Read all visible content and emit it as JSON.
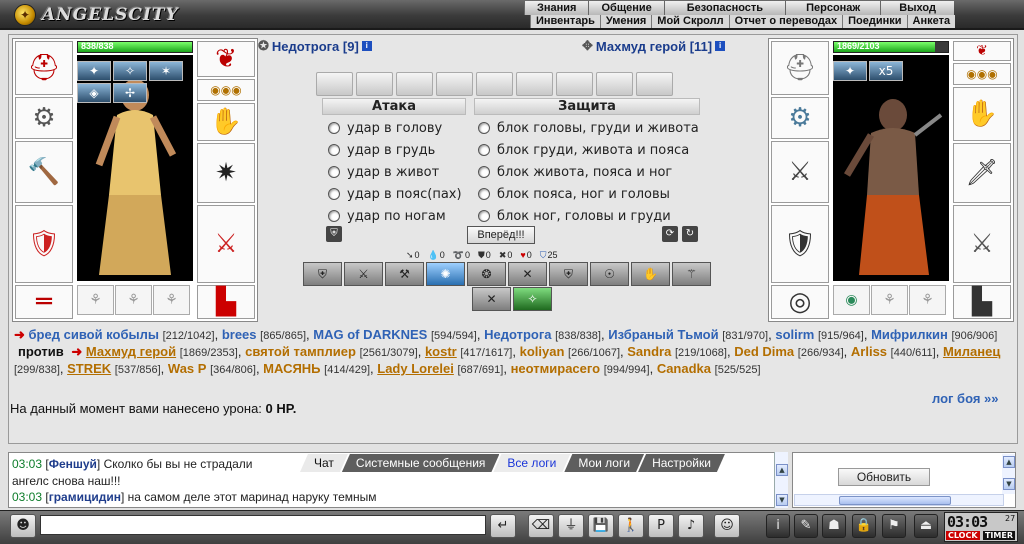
{
  "app": {
    "logo_text": "ANGELSCITY"
  },
  "top_menu": {
    "primary": [
      "Знания",
      "Общение",
      "Безопасность",
      "Персонаж",
      "Выход"
    ],
    "secondary": [
      "Инвентарь",
      "Умения",
      "Мой Скролл",
      "Отчет о переводах",
      "Поединки",
      "Анкета"
    ]
  },
  "player_left": {
    "name": "Недотрога [9]",
    "hp": "838/838",
    "hp_fraction": 1.0,
    "effects": [
      "✦",
      "✧",
      "✶",
      "◈",
      "✢"
    ]
  },
  "player_right": {
    "name": "Махмуд герой [11]",
    "hp": "1869/2103",
    "hp_fraction": 0.889,
    "effect_badge": "x5"
  },
  "attack": {
    "title": "Атака",
    "options": [
      "удар в голову",
      "удар в грудь",
      "удар в живот",
      "удар в пояс(пах)",
      "удар по ногам"
    ]
  },
  "defense": {
    "title": "Защита",
    "options": [
      "блок головы, груди и живота",
      "блок груди, живота и пояса",
      "блок живота, пояса и ног",
      "блок пояса, ног и головы",
      "блок ног, головы и груди"
    ]
  },
  "forward_button": "Вперёд!!!",
  "counters": [
    "0",
    "0",
    "0",
    "0",
    "0",
    "0",
    "25"
  ],
  "team_left": [
    {
      "name": "бред сивой кобылы",
      "hp": "[212/1042]"
    },
    {
      "name": "brees",
      "hp": "[865/865]"
    },
    {
      "name": "MAG of DARKNES",
      "hp": "[594/594]"
    },
    {
      "name": "Недотрога",
      "hp": "[838/838]"
    },
    {
      "name": "Избраный Тьмой",
      "hp": "[831/970]"
    },
    {
      "name": "solirm",
      "hp": "[915/964]"
    },
    {
      "name": "Мифрилкин",
      "hp": "[906/906]"
    }
  ],
  "versus_label": "против",
  "team_right": [
    {
      "name": "Махмуд герой",
      "hp": "[1869/2353]"
    },
    {
      "name": "святой тамплиер",
      "hp": "[2561/3079]"
    },
    {
      "name": "kostr",
      "hp": "[417/1617]"
    },
    {
      "name": "koliyan",
      "hp": "[266/1067]"
    },
    {
      "name": "Sandra",
      "hp": "[219/1068]"
    },
    {
      "name": "Ded Dima",
      "hp": "[266/934]"
    },
    {
      "name": "Arliss",
      "hp": "[440/611]"
    },
    {
      "name": "Миланец",
      "hp": "[299/838]"
    },
    {
      "name": "STREK",
      "hp": "[537/856]"
    },
    {
      "name": "Was P",
      "hp": "[364/806]"
    },
    {
      "name": "МАСЯНЬ",
      "hp": "[414/429]"
    },
    {
      "name": "Lady Lorelei",
      "hp": "[687/691]"
    },
    {
      "name": "неотмирасего",
      "hp": "[994/994]"
    },
    {
      "name": "Canadka",
      "hp": "[525/525]"
    }
  ],
  "damage_text": "На данный момент вами нанесено урона:",
  "damage_value": "0 HP.",
  "battle_log_link": "лог боя »»",
  "chat": {
    "lines": [
      {
        "time": "03:03",
        "nick": "Феншуй",
        "text": "Сколко бы вы не страдали"
      },
      {
        "time": "",
        "nick": "",
        "text": "ангелс снова наш!!!"
      },
      {
        "time": "03:03",
        "nick": "грамицидин",
        "text": "на самом деле этот маринад наруку темным"
      }
    ],
    "tabs": [
      "Чат",
      "Системные сообщения",
      "Все логи",
      "Мои логи",
      "Настройки"
    ],
    "input_value": ""
  },
  "refresh_button": "Обновить",
  "clock": {
    "time": "03:03",
    "seconds": "27",
    "label_clock": "CLOCK",
    "label_timer": "TIMER"
  },
  "colors": {
    "blue_name": "#2f62b5",
    "gold_name": "#b36e00",
    "chat_time": "#0e7d2b"
  }
}
